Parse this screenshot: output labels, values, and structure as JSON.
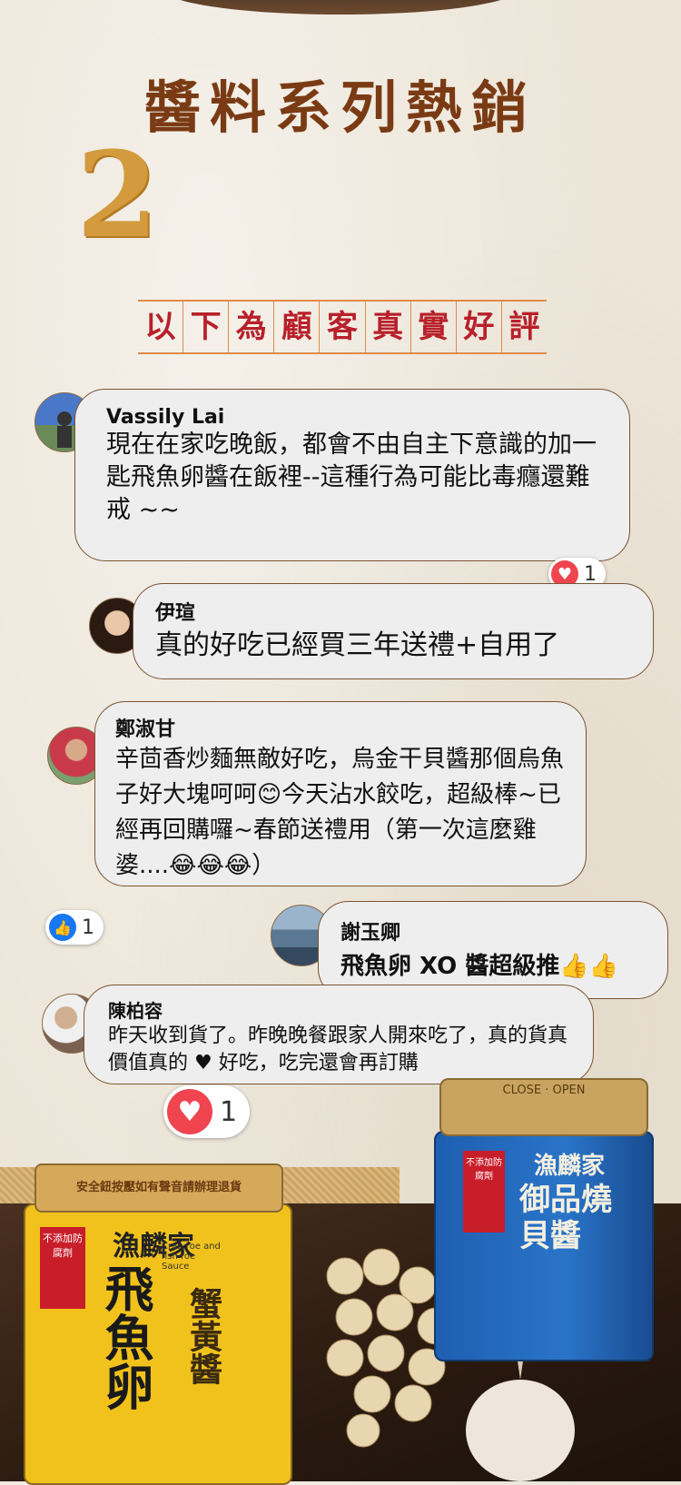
{
  "header": {
    "title": "醬料系列熱銷",
    "number": "2",
    "subtitle_chars": [
      "以",
      "下",
      "為",
      "顧",
      "客",
      "真",
      "實",
      "好",
      "評"
    ]
  },
  "reviews": [
    {
      "name": "Vassily Lai",
      "text": "現在在家吃晚飯，都會不由自主下意識的加一匙飛魚卵醬在飯裡--這種行為可能比毒癮還難戒 ~~",
      "reaction": {
        "type": "heart",
        "count": "1"
      }
    },
    {
      "name": "伊瑄",
      "text": "真的好吃已經買三年送禮+自用了"
    },
    {
      "name": "鄭淑甘",
      "text": "辛茴香炒麵無敵好吃，烏金干貝醬那個烏魚子好大塊呵呵😊今天沾水餃吃，超級棒~已經再回購囉~春節送禮用（第一次這麼雞婆....😂😂😂）"
    },
    {
      "name": "謝玉卿",
      "text": "飛魚卵 XO 醬超級推👍👍",
      "reaction": {
        "type": "like",
        "count": "1"
      }
    },
    {
      "name": "陳柏容",
      "text": "昨天收到貨了。昨晚晚餐跟家人開來吃了，真的貨真價值真的 ♥ 好吃，吃完還會再訂購",
      "reaction": {
        "type": "heart",
        "count": "1"
      }
    }
  ],
  "products": {
    "left_jar": {
      "cap_text": "安全鈕按壓如有聲音請辦理退貨",
      "brand": "漁麟家",
      "name": "飛魚卵",
      "sub": "蟹黃醬",
      "label_en": "Crab roe and fish roe Sauce",
      "badge": "不添加防腐劑"
    },
    "right_jar": {
      "cap_text": "CLOSE · OPEN",
      "brand": "漁麟家",
      "name": "御品燒貝醬",
      "badge": "不添加防腐劑"
    }
  },
  "colors": {
    "title": "#7a3b14",
    "subtitle": "#b8202a",
    "number": "#d39b3e",
    "bubble": "#eeeeee"
  }
}
